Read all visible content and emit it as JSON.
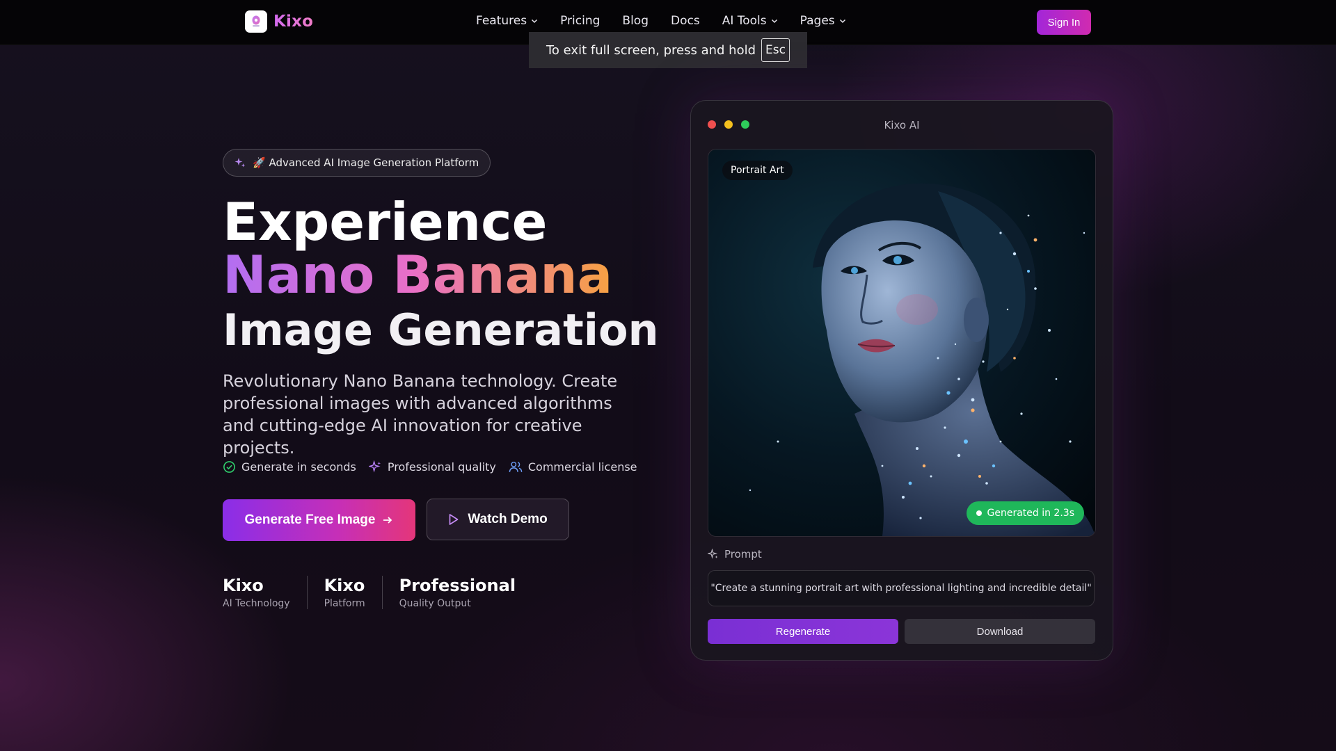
{
  "nav": {
    "brand": "Kixo",
    "items": [
      {
        "label": "Features",
        "dropdown": true
      },
      {
        "label": "Pricing",
        "dropdown": false
      },
      {
        "label": "Blog",
        "dropdown": false
      },
      {
        "label": "Docs",
        "dropdown": false
      },
      {
        "label": "AI Tools",
        "dropdown": true
      },
      {
        "label": "Pages",
        "dropdown": true
      }
    ],
    "sign_in": "Sign In"
  },
  "fullscreen_toast": {
    "text": "To exit full screen, press and hold",
    "key": "Esc"
  },
  "hero": {
    "badge": "🚀 Advanced AI Image Generation Platform",
    "title_line1": "Experience",
    "title_line2": "Nano Banana",
    "title_line3": "Image Generation",
    "description": "Revolutionary Nano Banana technology. Create professional images with advanced algorithms and cutting-edge AI innovation for creative projects.",
    "features": [
      "Generate in seconds",
      "Professional quality",
      "Commercial license"
    ],
    "primary_cta": "Generate Free Image",
    "secondary_cta": "Watch Demo",
    "stats": [
      {
        "value": "Kixo",
        "label": "AI Technology"
      },
      {
        "value": "Kixo",
        "label": "Platform"
      },
      {
        "value": "Professional",
        "label": "Quality Output"
      }
    ]
  },
  "app_card": {
    "title": "Kixo AI",
    "image_tag": "Portrait Art",
    "generated_badge": "Generated in 2.3s",
    "prompt_label": "Prompt",
    "prompt_text": "\"Create a stunning portrait art with professional lighting and incredible detail\"",
    "regenerate": "Regenerate",
    "download": "Download"
  },
  "colors": {
    "accent_purple": "#a326d8",
    "accent_pink": "#d02bb0",
    "success_green": "#1fb75a",
    "traffic_red": "#ef4f4f",
    "traffic_yellow": "#f4c01e",
    "traffic_green": "#2fcc5b"
  },
  "icons": [
    "sparkles-icon",
    "check-circle-icon",
    "users-icon",
    "arrow-right-icon",
    "play-icon",
    "chevron-down-icon"
  ]
}
